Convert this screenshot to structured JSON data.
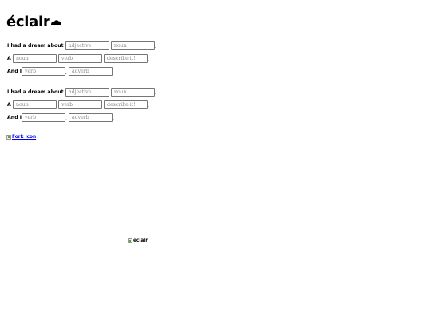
{
  "brand": {
    "name": "éclair",
    "icon": "cloud-icon"
  },
  "madlib": {
    "line1_prefix": "I had a dream about a",
    "line1_fields": [
      {
        "placeholder": "adjective",
        "value": ""
      },
      {
        "placeholder": "noun",
        "value": ""
      }
    ],
    "line2_prefix": "A",
    "line2_fields": [
      {
        "placeholder": "noun",
        "value": ""
      },
      {
        "placeholder": "verb",
        "value": ""
      },
      {
        "placeholder": "describe it!",
        "value": ""
      }
    ],
    "line3_prefix": "And I",
    "line3_fields": [
      {
        "placeholder": "verb",
        "value": ""
      },
      {
        "placeholder": "adverb",
        "value": ""
      }
    ],
    "comma": ",",
    "period": "."
  },
  "fork": {
    "alt": "Fork Icon",
    "icon": "broken-image-icon"
  },
  "footer_image": {
    "alt": "eclair",
    "icon": "broken-image-icon"
  }
}
